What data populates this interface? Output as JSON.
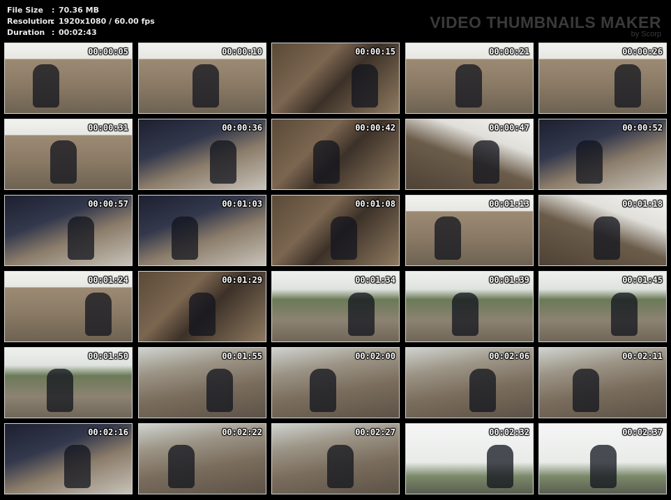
{
  "meta": {
    "file_size_label": "File Size",
    "file_size": "70.36 MB",
    "resolution_label": "Resolution",
    "resolution": "1920x1080 / 60.00 fps",
    "duration_label": "Duration",
    "duration": "00:02:43"
  },
  "brand": {
    "title": "VIDEO THUMBNAILS MAKER",
    "byline": "by Scorp"
  },
  "colors": {
    "background": "#000000",
    "thumb_border": "#d8d8d8",
    "timestamp": "#ffffff",
    "brand_text": "#3a3a3a"
  },
  "thumbnails": [
    {
      "time": "00:00:05",
      "scene": "wall"
    },
    {
      "time": "00:00:10",
      "scene": "wall"
    },
    {
      "time": "00:00:15",
      "scene": "leaves"
    },
    {
      "time": "00:00:21",
      "scene": "wall"
    },
    {
      "time": "00:00:26",
      "scene": "wall"
    },
    {
      "time": "00:00:31",
      "scene": "wall"
    },
    {
      "time": "00:00:36",
      "scene": "close"
    },
    {
      "time": "00:00:42",
      "scene": "leaves"
    },
    {
      "time": "00:00:47",
      "scene": "tilt"
    },
    {
      "time": "00:00:52",
      "scene": "close"
    },
    {
      "time": "00:00:57",
      "scene": "close"
    },
    {
      "time": "00:01:03",
      "scene": "close"
    },
    {
      "time": "00:01:08",
      "scene": "leaves"
    },
    {
      "time": "00:01:13",
      "scene": "wall"
    },
    {
      "time": "00:01:18",
      "scene": "tilt"
    },
    {
      "time": "00:01:24",
      "scene": "wall"
    },
    {
      "time": "00:01:29",
      "scene": "leaves"
    },
    {
      "time": "00:01:34",
      "scene": "park"
    },
    {
      "time": "00:01:39",
      "scene": "park"
    },
    {
      "time": "00:01:45",
      "scene": "park"
    },
    {
      "time": "00:01:50",
      "scene": "park"
    },
    {
      "time": "00:01:55",
      "scene": "steps"
    },
    {
      "time": "00:02:00",
      "scene": "steps"
    },
    {
      "time": "00:02:06",
      "scene": "steps"
    },
    {
      "time": "00:02:11",
      "scene": "steps"
    },
    {
      "time": "00:02:16",
      "scene": "close"
    },
    {
      "time": "00:02:22",
      "scene": "steps"
    },
    {
      "time": "00:02:27",
      "scene": "steps"
    },
    {
      "time": "00:02:32",
      "scene": "sky"
    },
    {
      "time": "00:02:37",
      "scene": "sky"
    }
  ]
}
